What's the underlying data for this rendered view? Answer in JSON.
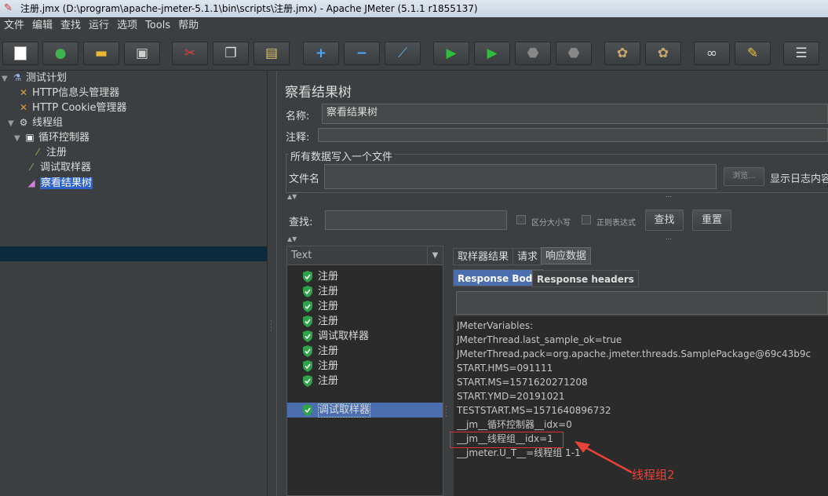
{
  "window": {
    "title": "注册.jmx (D:\\program\\apache-jmeter-5.1.1\\bin\\scripts\\注册.jmx) - Apache JMeter (5.1.1 r1855137)"
  },
  "menu": [
    "文件",
    "编辑",
    "查找",
    "运行",
    "选项",
    "Tools",
    "帮助"
  ],
  "toolbar": {
    "icons": [
      "new-icon",
      "templates-icon",
      "open-icon",
      "save-icon",
      "cut-icon",
      "copy-icon",
      "paste-icon",
      "expand-icon",
      "collapse-icon",
      "toggle-icon",
      "start-icon",
      "start-no-pause-icon",
      "stop-icon",
      "shutdown-icon",
      "clear-icon",
      "clear-all-icon",
      "search-icon",
      "reset-search-icon",
      "function-helper-icon"
    ]
  },
  "tree": {
    "items": [
      {
        "label": "测试计划",
        "icon": "flask-icon"
      },
      {
        "label": "HTTP信息头管理器",
        "icon": "tools-icon"
      },
      {
        "label": "HTTP Cookie管理器",
        "icon": "tools-icon"
      },
      {
        "label": "线程组",
        "icon": "gear-icon"
      },
      {
        "label": "循环控制器",
        "icon": "controller-icon"
      },
      {
        "label": "注册",
        "icon": "sampler-icon"
      },
      {
        "label": "调试取样器",
        "icon": "sampler-icon"
      },
      {
        "label": "察看结果树",
        "icon": "listener-icon"
      }
    ]
  },
  "panel": {
    "title": "察看结果树",
    "name_label": "名称:",
    "name_value": "察看结果树",
    "comment_label": "注释:",
    "file_group": "所有数据写入一个文件",
    "filename_label": "文件名",
    "browse": "浏览...",
    "log_label": "显示日志内容",
    "search_label": "查找:",
    "case_label": "区分大小写",
    "regex_label": "正则表达式",
    "find_button": "查找",
    "reset_button": "重置"
  },
  "results": {
    "renderer": "Text",
    "items": [
      "注册",
      "注册",
      "注册",
      "注册",
      "调试取样器",
      "注册",
      "注册",
      "注册",
      "调试取样器"
    ],
    "tabs": [
      "取样器结果",
      "请求",
      "响应数据"
    ],
    "subtabs": [
      "Response Body",
      "Response headers"
    ],
    "response_lines": [
      "JMeterVariables:",
      "JMeterThread.last_sample_ok=true",
      "JMeterThread.pack=org.apache.jmeter.threads.SamplePackage@69c43b9c",
      "START.HMS=091111",
      "START.MS=1571620271208",
      "START.YMD=20191021",
      "TESTSTART.MS=1571640896732",
      "__jm__循环控制器__idx=0",
      "__jm__线程组__idx=1",
      "__jmeter.U_T__=线程组 1-1"
    ]
  },
  "annotation": {
    "text": "线程组2",
    "color": "#e8423a"
  }
}
